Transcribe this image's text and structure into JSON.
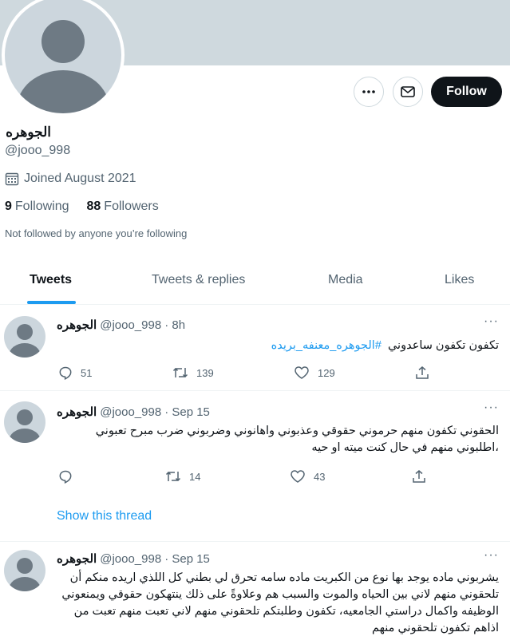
{
  "profile": {
    "display_name": "الجوهره",
    "handle": "@jooo_998",
    "joined": "Joined August 2021",
    "following_count": "9",
    "following_label": "Following",
    "followers_count": "88",
    "followers_label": "Followers",
    "not_followed": "Not followed by anyone you’re following"
  },
  "actions": {
    "follow_label": "Follow",
    "more_icon": "more-icon",
    "message_icon": "envelope-icon"
  },
  "tabs": [
    {
      "label": "Tweets"
    },
    {
      "label": "Tweets & replies"
    },
    {
      "label": "Media"
    },
    {
      "label": "Likes"
    }
  ],
  "tweets": [
    {
      "name": "الجوهره",
      "handle": "@jooo_998",
      "time": "· 8h",
      "text": "تكفون تكفون ساعدوني",
      "hashtag": "#الجوهره_معنفه_بريده",
      "replies": "51",
      "retweets": "139",
      "likes": "129"
    },
    {
      "name": "الجوهره",
      "handle": "@jooo_998",
      "time": "· Sep 15",
      "text": "الحقوني تكفون منهم حرموني حقوقي وعذبوني واهانوني وضربوني ضرب مبرح تعبوني ،اطلبوني منهم في حال كنت ميته او حيه",
      "replies": "",
      "retweets": "14",
      "likes": "43",
      "show_thread": "Show this thread"
    },
    {
      "name": "الجوهره",
      "handle": "@jooo_998",
      "time": "· Sep 15",
      "text": "يشربوني ماده يوجد بها نوع من الكبريت ماده سامه تحرق لي بطني كل اللذي اريده منكم أن تلحقوني منهم لاني بين الحياه والموت والسبب هم وعلاوةً على ذلك ينتهكون حقوقي ويمنعوني الوظيفه واكمال دراستي الجامعيه، تكفون وطلبتكم تلحقوني منهم لاني تعبت منهم تعبت من اذاهم تكفون تلحقوني منهم"
    }
  ]
}
